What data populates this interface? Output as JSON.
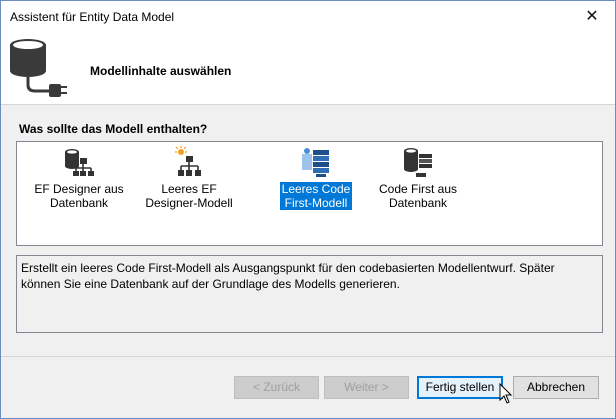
{
  "window": {
    "title": "Assistent für Entity Data Model",
    "close_glyph": "✕"
  },
  "header": {
    "title": "Modellinhalte auswählen",
    "icon": "database-plug-icon"
  },
  "content": {
    "question": "Was sollte das Modell enthalten?",
    "items": [
      {
        "label_line1": "EF Designer aus",
        "label_line2": "Datenbank",
        "icon": "database-diagram-icon",
        "selected": false
      },
      {
        "label_line1": "Leeres EF",
        "label_line2": "Designer-Modell",
        "icon": "empty-diagram-icon",
        "selected": false
      },
      {
        "label_line1": "Leeres Code",
        "label_line2": "First-Modell",
        "icon": "code-first-empty-icon",
        "selected": true
      },
      {
        "label_line1": "Code First aus",
        "label_line2": "Datenbank",
        "icon": "database-code-first-icon",
        "selected": false
      }
    ],
    "description": "Erstellt ein leeres Code First-Modell als Ausgangspunkt für den codebasierten Modellentwurf. Später können Sie eine Datenbank auf der Grundlage des Modells generieren."
  },
  "buttons": {
    "back": "< Zurück",
    "next": "Weiter >",
    "finish": "Fertig stellen",
    "cancel": "Abbrechen"
  },
  "colors": {
    "selection": "#0078d7",
    "accent_border": "#0078d7"
  }
}
